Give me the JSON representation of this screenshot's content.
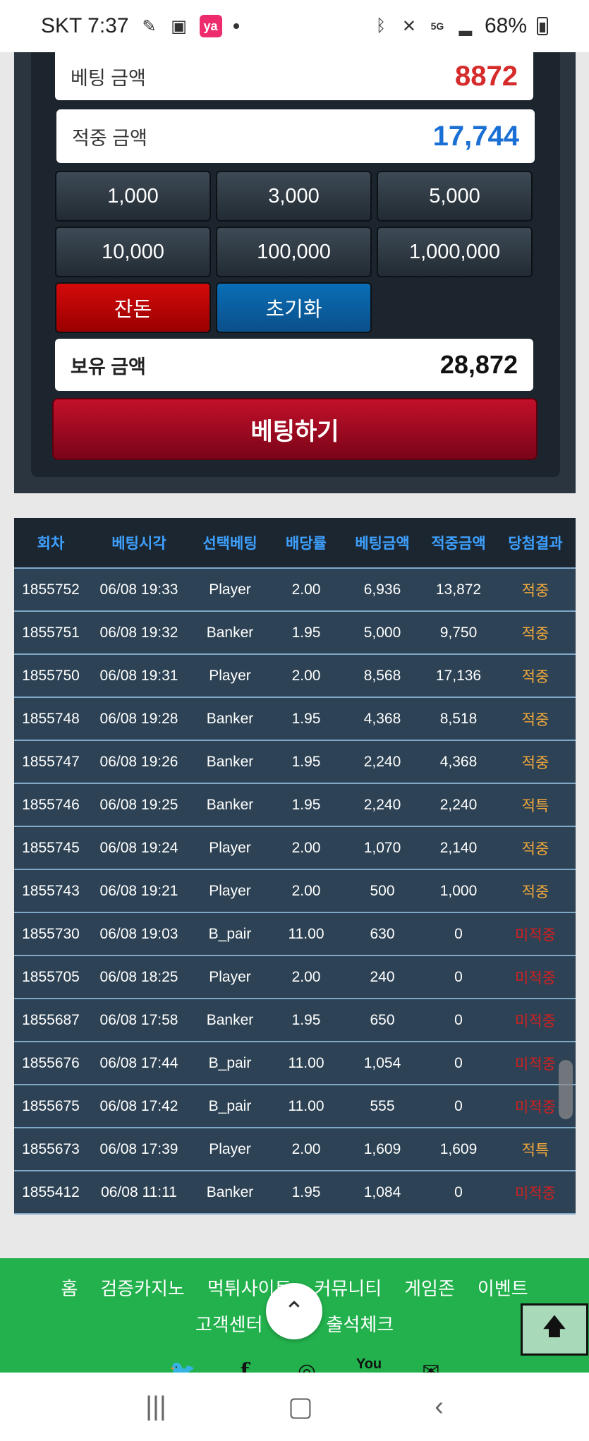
{
  "status_bar": {
    "carrier_time": "SKT 7:37",
    "icons": [
      "pill-icon",
      "image-icon",
      "ya-app-icon",
      "bluetooth-icon",
      "mute-icon",
      "5g-icon",
      "signal-icon"
    ],
    "ya_label": "ya",
    "battery": "68%"
  },
  "betting": {
    "bet_amount_label": "베팅 금액",
    "bet_amount_value": "8872",
    "win_amount_label": "적중 금액",
    "win_amount_value": "17,744",
    "chips": [
      "1,000",
      "3,000",
      "5,000",
      "10,000",
      "100,000",
      "1,000,000"
    ],
    "change_label": "잔돈",
    "reset_label": "초기화",
    "hold_label": "보유 금액",
    "hold_value": "28,872",
    "bet_button": "베팅하기"
  },
  "table": {
    "headers": [
      "회차",
      "베팅시각",
      "선택베팅",
      "배당률",
      "베팅금액",
      "적중금액",
      "당첨결과"
    ],
    "rows": [
      [
        "1855752",
        "06/08 19:33",
        "Player",
        "2.00",
        "6,936",
        "13,872",
        "적중"
      ],
      [
        "1855751",
        "06/08 19:32",
        "Banker",
        "1.95",
        "5,000",
        "9,750",
        "적중"
      ],
      [
        "1855750",
        "06/08 19:31",
        "Player",
        "2.00",
        "8,568",
        "17,136",
        "적중"
      ],
      [
        "1855748",
        "06/08 19:28",
        "Banker",
        "1.95",
        "4,368",
        "8,518",
        "적중"
      ],
      [
        "1855747",
        "06/08 19:26",
        "Banker",
        "1.95",
        "2,240",
        "4,368",
        "적중"
      ],
      [
        "1855746",
        "06/08 19:25",
        "Banker",
        "1.95",
        "2,240",
        "2,240",
        "적특"
      ],
      [
        "1855745",
        "06/08 19:24",
        "Player",
        "2.00",
        "1,070",
        "2,140",
        "적중"
      ],
      [
        "1855743",
        "06/08 19:21",
        "Player",
        "2.00",
        "500",
        "1,000",
        "적중"
      ],
      [
        "1855730",
        "06/08 19:03",
        "B_pair",
        "11.00",
        "630",
        "0",
        "미적중"
      ],
      [
        "1855705",
        "06/08 18:25",
        "Player",
        "2.00",
        "240",
        "0",
        "미적중"
      ],
      [
        "1855687",
        "06/08 17:58",
        "Banker",
        "1.95",
        "650",
        "0",
        "미적중"
      ],
      [
        "1855676",
        "06/08 17:44",
        "B_pair",
        "11.00",
        "1,054",
        "0",
        "미적중"
      ],
      [
        "1855675",
        "06/08 17:42",
        "B_pair",
        "11.00",
        "555",
        "0",
        "미적중"
      ],
      [
        "1855673",
        "06/08 17:39",
        "Player",
        "2.00",
        "1,609",
        "1,609",
        "적특"
      ],
      [
        "1855412",
        "06/08 11:11",
        "Banker",
        "1.95",
        "1,084",
        "0",
        "미적중"
      ]
    ]
  },
  "footer": {
    "nav_row1": [
      "홈",
      "검증카지노",
      "먹튀사이트",
      "커뮤니티",
      "게임존",
      "이벤트"
    ],
    "nav_row2": [
      "고객센터",
      "출석체크"
    ],
    "socials": [
      "twitter-icon",
      "facebook-icon",
      "instagram-icon",
      "youtube-icon",
      "mail-icon"
    ]
  },
  "colors": {
    "bet_value": "#d52b2b",
    "win_value": "#1a6fd4",
    "table_header_text": "#3ea1ff",
    "row_bg": "#2d4254",
    "result_win": "#f2a93b",
    "result_lose": "#d42020",
    "footer_bg": "#22b14c"
  }
}
